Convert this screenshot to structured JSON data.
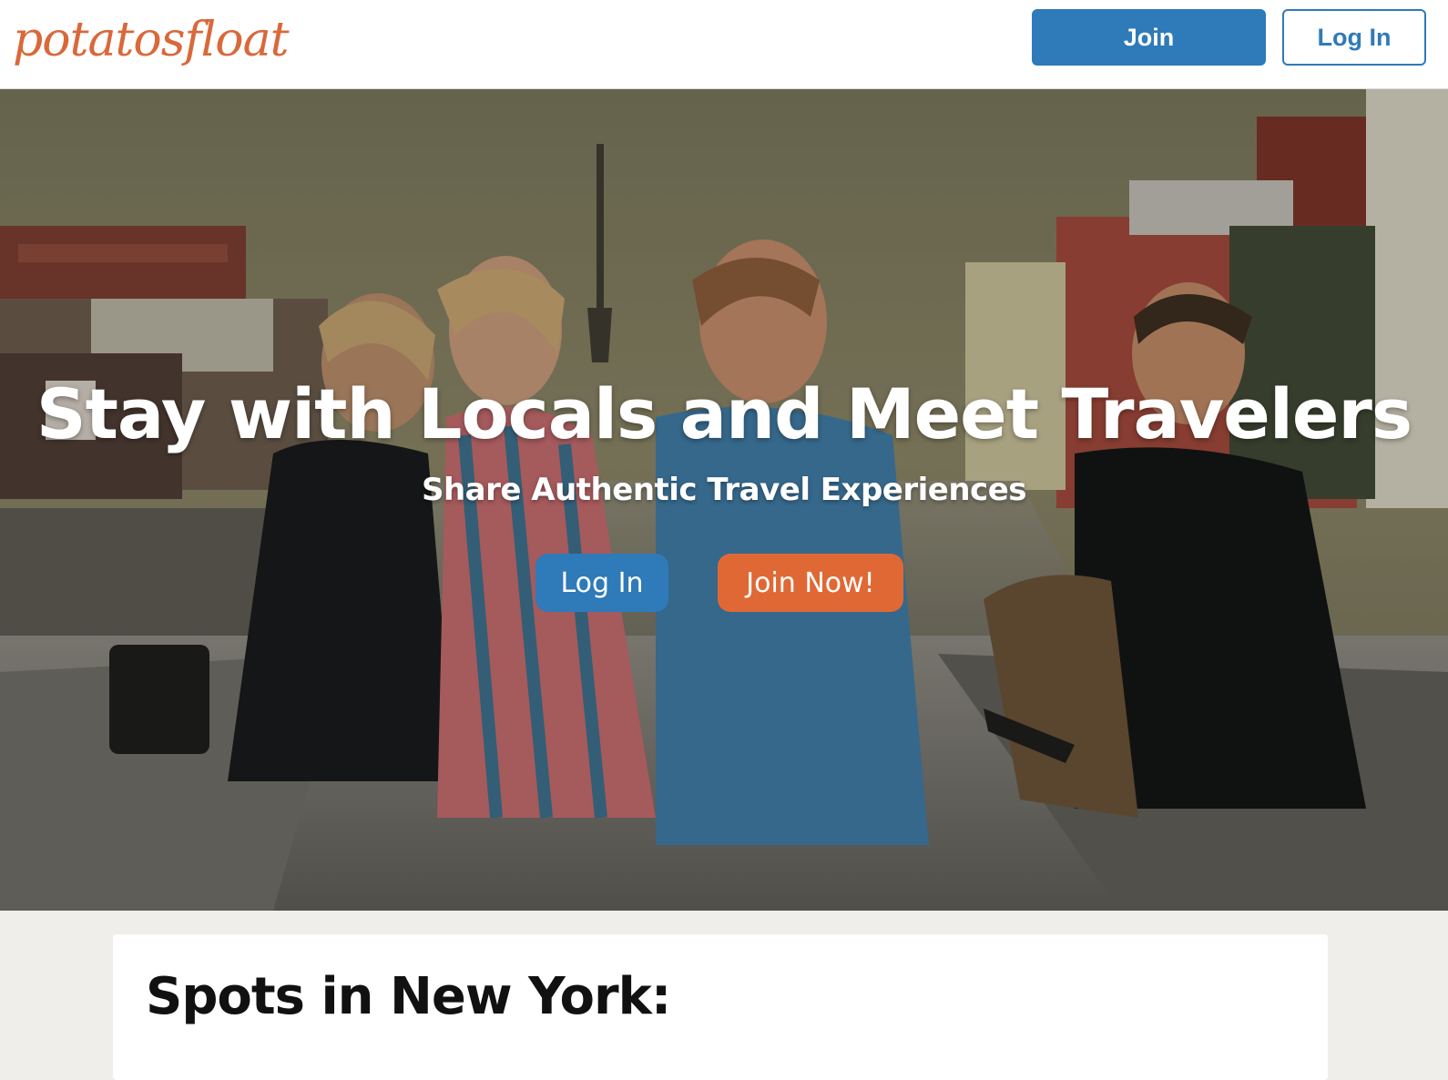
{
  "header": {
    "logo_text": "potatosfloat",
    "join_label": "Join",
    "login_label": "Log In"
  },
  "hero": {
    "title": "Stay with Locals and Meet Travelers",
    "subtitle": "Share Authentic Travel Experiences",
    "login_label": "Log In",
    "join_label": "Join Now!"
  },
  "content": {
    "section_title": "Spots in New York:"
  },
  "colors": {
    "brand": "#d9683a",
    "primary": "#2f7ab8",
    "accent": "#e06834",
    "page_background": "#f0eeea"
  }
}
